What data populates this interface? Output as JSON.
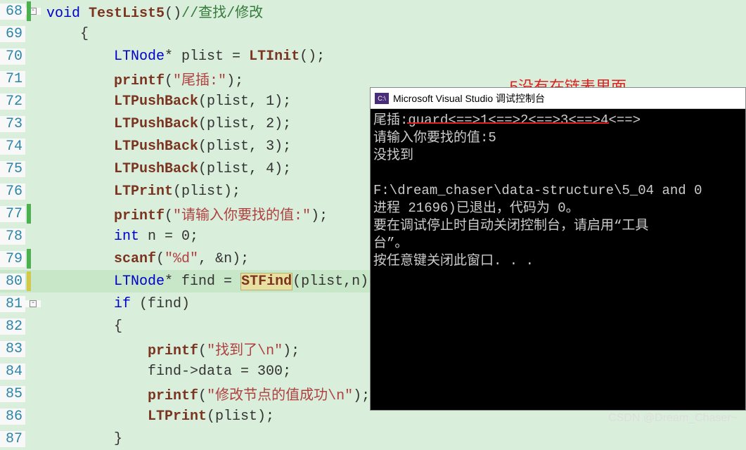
{
  "annotation": "5没有在链表里面",
  "console": {
    "title": "Microsoft Visual Studio 调试控制台",
    "icon": "C:\\",
    "lines": [
      "尾插:guard<==>1<==>2<==>3<==>4<==>",
      "请输入你要找的值:5",
      "没找到",
      "",
      "F:\\dream_chaser\\data-structure\\5_04 and 0",
      "进程 21696)已退出，代码为 0。",
      "要在调试停止时自动关闭控制台，请启用“工具",
      "台”。",
      "按任意键关闭此窗口. . ."
    ]
  },
  "watermark": "CSDN @Dream_Chaser~",
  "chart_data": null,
  "code_lines": [
    {
      "no": "68",
      "marker": "green",
      "fold": "-",
      "tokens": [
        [
          "kw",
          "void"
        ],
        [
          "ident",
          " "
        ],
        [
          "func",
          "TestList5"
        ],
        [
          "ident",
          "()"
        ],
        [
          "comment",
          "//查找/修改"
        ]
      ],
      "indent": 0
    },
    {
      "no": "69",
      "marker": "",
      "fold": "",
      "tokens": [
        [
          "ident",
          "{"
        ]
      ],
      "indent": 1
    },
    {
      "no": "70",
      "marker": "",
      "fold": "",
      "tokens": [
        [
          "type",
          "LTNode"
        ],
        [
          "ident",
          "* plist = "
        ],
        [
          "func",
          "LTInit"
        ],
        [
          "ident",
          "();"
        ]
      ],
      "indent": 2
    },
    {
      "no": "71",
      "marker": "",
      "fold": "",
      "tokens": [
        [
          "func",
          "printf"
        ],
        [
          "ident",
          "("
        ],
        [
          "str",
          "\"尾插:\""
        ],
        [
          "ident",
          ");"
        ]
      ],
      "indent": 2
    },
    {
      "no": "72",
      "marker": "",
      "fold": "",
      "tokens": [
        [
          "func",
          "LTPushBack"
        ],
        [
          "ident",
          "(plist, 1);"
        ]
      ],
      "indent": 2
    },
    {
      "no": "73",
      "marker": "",
      "fold": "",
      "tokens": [
        [
          "func",
          "LTPushBack"
        ],
        [
          "ident",
          "(plist, 2);"
        ]
      ],
      "indent": 2
    },
    {
      "no": "74",
      "marker": "",
      "fold": "",
      "tokens": [
        [
          "func",
          "LTPushBack"
        ],
        [
          "ident",
          "(plist, 3);"
        ]
      ],
      "indent": 2
    },
    {
      "no": "75",
      "marker": "",
      "fold": "",
      "tokens": [
        [
          "func",
          "LTPushBack"
        ],
        [
          "ident",
          "(plist, 4);"
        ]
      ],
      "indent": 2
    },
    {
      "no": "76",
      "marker": "",
      "fold": "",
      "tokens": [
        [
          "func",
          "LTPrint"
        ],
        [
          "ident",
          "(plist);"
        ]
      ],
      "indent": 2
    },
    {
      "no": "77",
      "marker": "green",
      "fold": "",
      "tokens": [
        [
          "func",
          "printf"
        ],
        [
          "ident",
          "("
        ],
        [
          "str",
          "\"请输入你要找的值:\""
        ],
        [
          "ident",
          ");"
        ]
      ],
      "indent": 2
    },
    {
      "no": "78",
      "marker": "",
      "fold": "",
      "tokens": [
        [
          "kw",
          "int"
        ],
        [
          "ident",
          " n = 0;"
        ]
      ],
      "indent": 2
    },
    {
      "no": "79",
      "marker": "green",
      "fold": "",
      "tokens": [
        [
          "func",
          "scanf"
        ],
        [
          "ident",
          "("
        ],
        [
          "str",
          "\"%d\""
        ],
        [
          "ident",
          ", &n);"
        ]
      ],
      "indent": 2
    },
    {
      "no": "80",
      "marker": "yellow",
      "fold": "",
      "hl": true,
      "tokens": [
        [
          "type",
          "LTNode"
        ],
        [
          "ident",
          "* find = "
        ],
        [
          "funcbox",
          "STFind"
        ],
        [
          "ident",
          "(plist,n);"
        ]
      ],
      "indent": 2
    },
    {
      "no": "81",
      "marker": "",
      "fold": "-",
      "tokens": [
        [
          "kw",
          "if"
        ],
        [
          "ident",
          " (find)"
        ]
      ],
      "indent": 2
    },
    {
      "no": "82",
      "marker": "",
      "fold": "",
      "tokens": [
        [
          "ident",
          "{"
        ]
      ],
      "indent": 2
    },
    {
      "no": "83",
      "marker": "",
      "fold": "",
      "tokens": [
        [
          "func",
          "printf"
        ],
        [
          "ident",
          "("
        ],
        [
          "str",
          "\"找到了\\n\""
        ],
        [
          "ident",
          ");"
        ]
      ],
      "indent": 3
    },
    {
      "no": "84",
      "marker": "",
      "fold": "",
      "tokens": [
        [
          "ident",
          "find->data = 300;"
        ]
      ],
      "indent": 3
    },
    {
      "no": "85",
      "marker": "",
      "fold": "",
      "tokens": [
        [
          "func",
          "printf"
        ],
        [
          "ident",
          "("
        ],
        [
          "str",
          "\"修改节点的值成功\\n\""
        ],
        [
          "ident",
          ");"
        ]
      ],
      "indent": 3
    },
    {
      "no": "86",
      "marker": "",
      "fold": "",
      "tokens": [
        [
          "func",
          "LTPrint"
        ],
        [
          "ident",
          "(plist);"
        ]
      ],
      "indent": 3
    },
    {
      "no": "87",
      "marker": "",
      "fold": "",
      "tokens": [
        [
          "ident",
          "}"
        ]
      ],
      "indent": 2
    }
  ]
}
